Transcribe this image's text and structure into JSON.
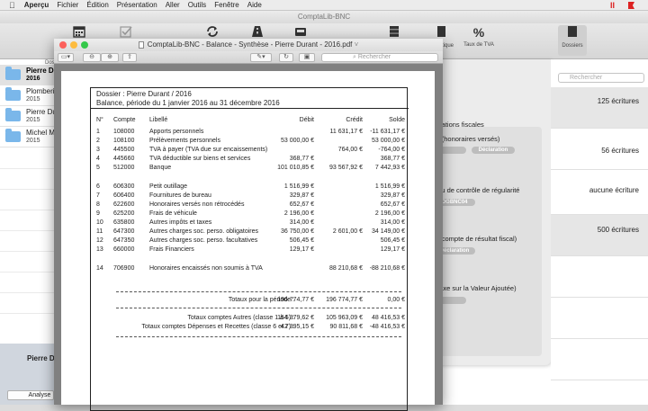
{
  "menubar": {
    "apple": "",
    "app_name": "Aperçu",
    "items": [
      "Fichier",
      "Édition",
      "Présentation",
      "Aller",
      "Outils",
      "Fenêtre",
      "Aide"
    ]
  },
  "bg_window": {
    "title": "ComptaLib-BNC",
    "toolbar": [
      {
        "label": "",
        "icon": "calendar-icon"
      },
      {
        "label": "",
        "icon": "checkbox-icon"
      },
      {
        "label": "",
        "icon": "sync-icon"
      },
      {
        "label": "",
        "icon": "road-icon"
      },
      {
        "label": "",
        "icon": "inbox-icon"
      },
      {
        "label": "",
        "icon": "server-icon"
      },
      {
        "label": "Analytique",
        "icon": "book-icon"
      },
      {
        "label": "Taux de TVA",
        "icon": "percent-icon",
        "glyph": "%"
      },
      {
        "label": "Dossiers",
        "icon": "folder-icon"
      }
    ],
    "sidebar_header": "Dos",
    "sidebar_items": [
      {
        "name": "Pierre Du",
        "year": "2016",
        "selected": true
      },
      {
        "name": "Plomberi",
        "year": "2015",
        "selected": false
      },
      {
        "name": "Pierre Du",
        "year": "2015",
        "selected": false
      },
      {
        "name": "Michel M",
        "year": "2015",
        "selected": false
      }
    ],
    "sidebar_bottom_name": "Pierre D",
    "analyse_button": "Analyse",
    "search_placeholder": "Rechercher",
    "right_rows": [
      "125 écritures",
      "56 écritures",
      "aucune écriture",
      "500 écritures"
    ],
    "panel": {
      "section_title": "érations fiscales",
      "entries": [
        {
          "text": "-2 (honoraires versés)",
          "badges": [
            "Déclaration"
          ]
        },
        {
          "text": "eau de contrôle de régularité",
          "badges": [
            "OGBNC04"
          ]
        },
        {
          "text": "5 (compte de résultat fiscal)",
          "badges": [
            "Déclaration"
          ]
        },
        {
          "text": "(Taxe sur la Valeur Ajoutée)",
          "badges": []
        }
      ]
    }
  },
  "preview": {
    "title": "ComptaLib-BNC - Balance - Synthèse - Pierre Durant - 2016.pdf",
    "search_placeholder": "Rechercher",
    "doc": {
      "line1": "Dossier : Pierre Durant / 2016",
      "line2": "Balance, période du 1 janvier 2016 au 31 décembre 2016",
      "headers": {
        "no": "N°",
        "compte": "Compte",
        "libelle": "Libellé",
        "debit": "Débit",
        "credit": "Crédit",
        "solde": "Solde"
      },
      "rows": [
        {
          "no": "1",
          "compte": "108000",
          "libelle": "Apports personnels",
          "debit": "",
          "credit": "11 631,17 €",
          "solde": "-11 631,17 €"
        },
        {
          "no": "2",
          "compte": "108100",
          "libelle": "Prélèvements personnels",
          "debit": "53 000,00 €",
          "credit": "",
          "solde": "53 000,00 €"
        },
        {
          "no": "3",
          "compte": "445500",
          "libelle": "TVA à payer (TVA due sur encaissements)",
          "debit": "",
          "credit": "764,00 €",
          "solde": "-764,00 €"
        },
        {
          "no": "4",
          "compte": "445660",
          "libelle": "TVA déductible sur biens et services",
          "debit": "368,77 €",
          "credit": "",
          "solde": "368,77 €"
        },
        {
          "no": "5",
          "compte": "512000",
          "libelle": "Banque",
          "debit": "101 010,85 €",
          "credit": "93 567,92 €",
          "solde": "7 442,93 €"
        },
        {
          "no": "6",
          "compte": "606300",
          "libelle": "Petit outillage",
          "debit": "1 516,99 €",
          "credit": "",
          "solde": "1 516,99 €"
        },
        {
          "no": "7",
          "compte": "606400",
          "libelle": "Fournitures de bureau",
          "debit": "329,87 €",
          "credit": "",
          "solde": "329,87 €"
        },
        {
          "no": "8",
          "compte": "622600",
          "libelle": "Honoraires versés non rétrocédés",
          "debit": "652,67 €",
          "credit": "",
          "solde": "652,67 €"
        },
        {
          "no": "9",
          "compte": "625200",
          "libelle": "Frais de véhicule",
          "debit": "2 196,00 €",
          "credit": "",
          "solde": "2 196,00 €"
        },
        {
          "no": "10",
          "compte": "635800",
          "libelle": "Autres impôts et taxes",
          "debit": "314,00 €",
          "credit": "",
          "solde": "314,00 €"
        },
        {
          "no": "11",
          "compte": "647300",
          "libelle": "Autres charges soc. perso. obligatoires",
          "debit": "36 750,00 €",
          "credit": "2 601,00 €",
          "solde": "34 149,00 €"
        },
        {
          "no": "12",
          "compte": "647350",
          "libelle": "Autres charges soc. perso. facultatives",
          "debit": "506,45 €",
          "credit": "",
          "solde": "506,45 €"
        },
        {
          "no": "13",
          "compte": "660000",
          "libelle": "Frais Financiers",
          "debit": "129,17 €",
          "credit": "",
          "solde": "129,17 €"
        },
        {
          "no": "14",
          "compte": "706900",
          "libelle": "Honoraires encaissés non soumis à TVA",
          "debit": "",
          "credit": "88 210,68 €",
          "solde": "-88 210,68 €"
        }
      ],
      "totals": [
        {
          "label": "Totaux pour la période :",
          "debit": "196 774,77 €",
          "credit": "196 774,77 €",
          "solde": "0,00 €"
        },
        {
          "label": "Totaux comptes Autres (classe 1 à 5) :",
          "debit": "154 379,62 €",
          "credit": "105 963,09 €",
          "solde": "48 416,53 €"
        },
        {
          "label": "Totaux comptes Dépenses et Recettes (classe 6 et 7) :",
          "debit": "42 395,15 €",
          "credit": "90 811,68 €",
          "solde": "-48 416,53 €"
        }
      ]
    }
  },
  "colors": {
    "folder": "#7ab7ea",
    "close": "#fc605c",
    "minimize": "#fdbc40",
    "zoom": "#34c84a"
  }
}
